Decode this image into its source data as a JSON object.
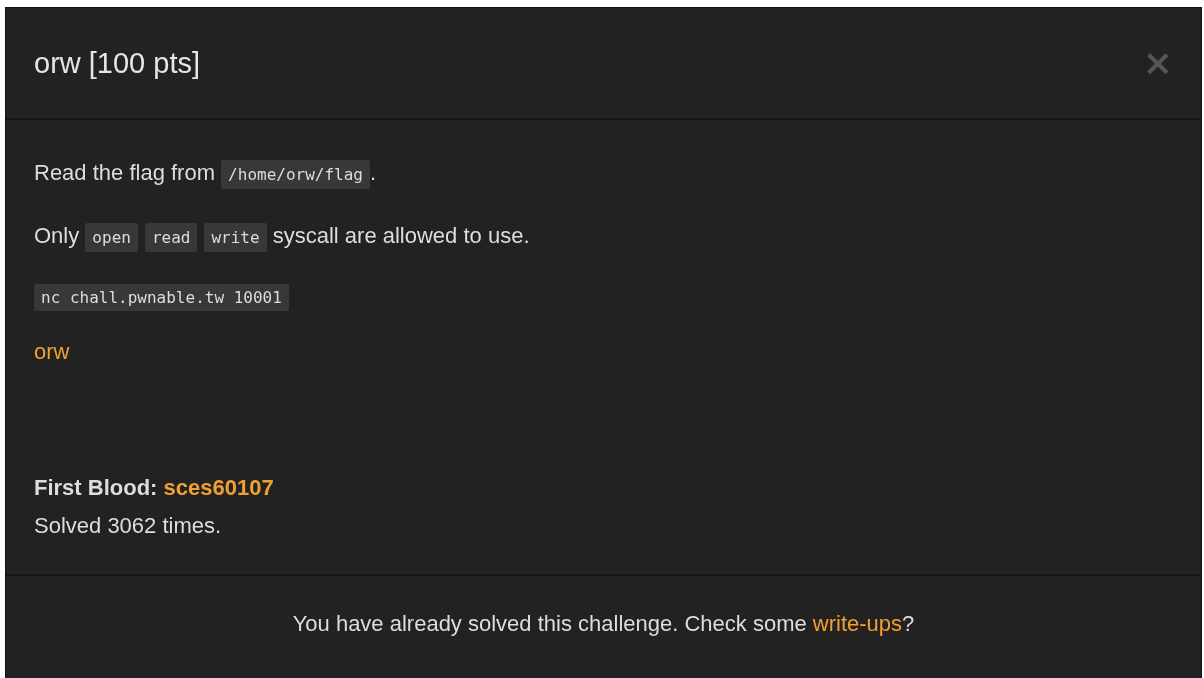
{
  "dialog": {
    "title": "orw [100 pts]",
    "close_label": "×"
  },
  "description": [
    {
      "kind": "sentence",
      "parts": [
        {
          "kind": "text",
          "text": "Read the flag from "
        },
        {
          "kind": "code",
          "text": "/home/orw/flag"
        },
        {
          "kind": "text",
          "text": "."
        }
      ]
    },
    {
      "kind": "sentence",
      "parts": [
        {
          "kind": "text",
          "text": "Only "
        },
        {
          "kind": "code",
          "text": "open"
        },
        {
          "kind": "code",
          "text": "read"
        },
        {
          "kind": "code",
          "text": "write"
        },
        {
          "kind": "text",
          "text": " syscall are allowed to use."
        }
      ]
    },
    {
      "kind": "command",
      "text": "nc chall.pwnable.tw 10001"
    },
    {
      "kind": "link",
      "text": "orw"
    }
  ],
  "first_blood": {
    "label": "First Blood:",
    "user": "sces60107"
  },
  "solved_count": "Solved 3062 times.",
  "footer": {
    "text": "You have already solved this challenge. Check some ",
    "link": "write-ups",
    "suffix": "?"
  }
}
